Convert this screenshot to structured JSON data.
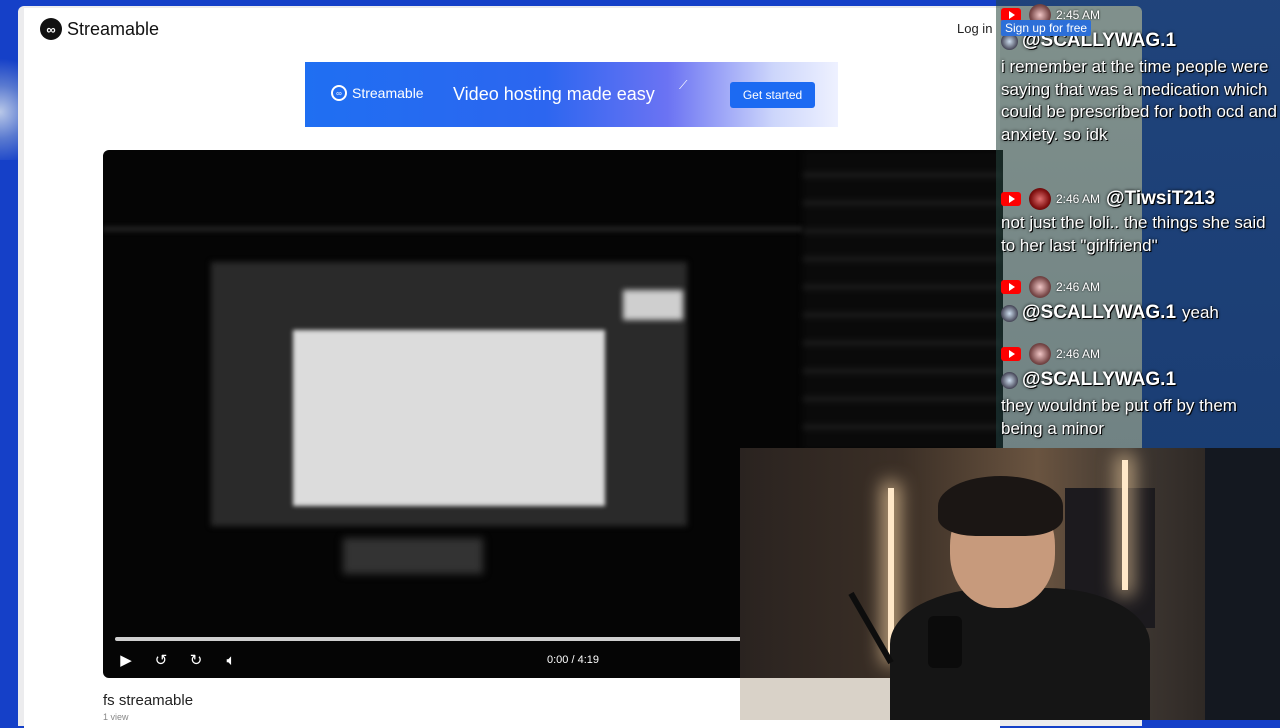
{
  "site": {
    "logo_text": "Streamable",
    "login_label": "Log in"
  },
  "banner": {
    "brand": "Streamable",
    "headline": "Video hosting made easy",
    "cta_label": "Get started"
  },
  "player": {
    "time": "0:00 / 4:19",
    "progress_fraction": 0.0
  },
  "video": {
    "title": "fs streamable",
    "views": "1 view"
  },
  "overlay": {
    "signup_label": "Sign up for free"
  },
  "chat": {
    "messages": [
      {
        "time": "2:45 AM",
        "user": "@SCALLYWAG.1",
        "text": "i remember at the time people were saying that was a medication which could be prescribed for both ocd and anxiety. so idk"
      },
      {
        "time": "2:46 AM",
        "user": "@TiwsiT213",
        "text": "not just the loli.. the things she said to her last \"girlfriend\""
      },
      {
        "time": "2:46 AM",
        "user": "@SCALLYWAG.1",
        "text": "yeah"
      },
      {
        "time": "2:46 AM",
        "user": "@SCALLYWAG.1",
        "text": "they wouldnt be put off by them being a minor"
      }
    ]
  },
  "colors": {
    "desktop_bg": "#1540c8",
    "banner_blue": "#1f6ff2",
    "youtube_red": "#ff0000"
  },
  "icons": [
    "play-icon",
    "rewind-10-icon",
    "forward-10-icon",
    "volume-icon",
    "youtube-icon"
  ]
}
